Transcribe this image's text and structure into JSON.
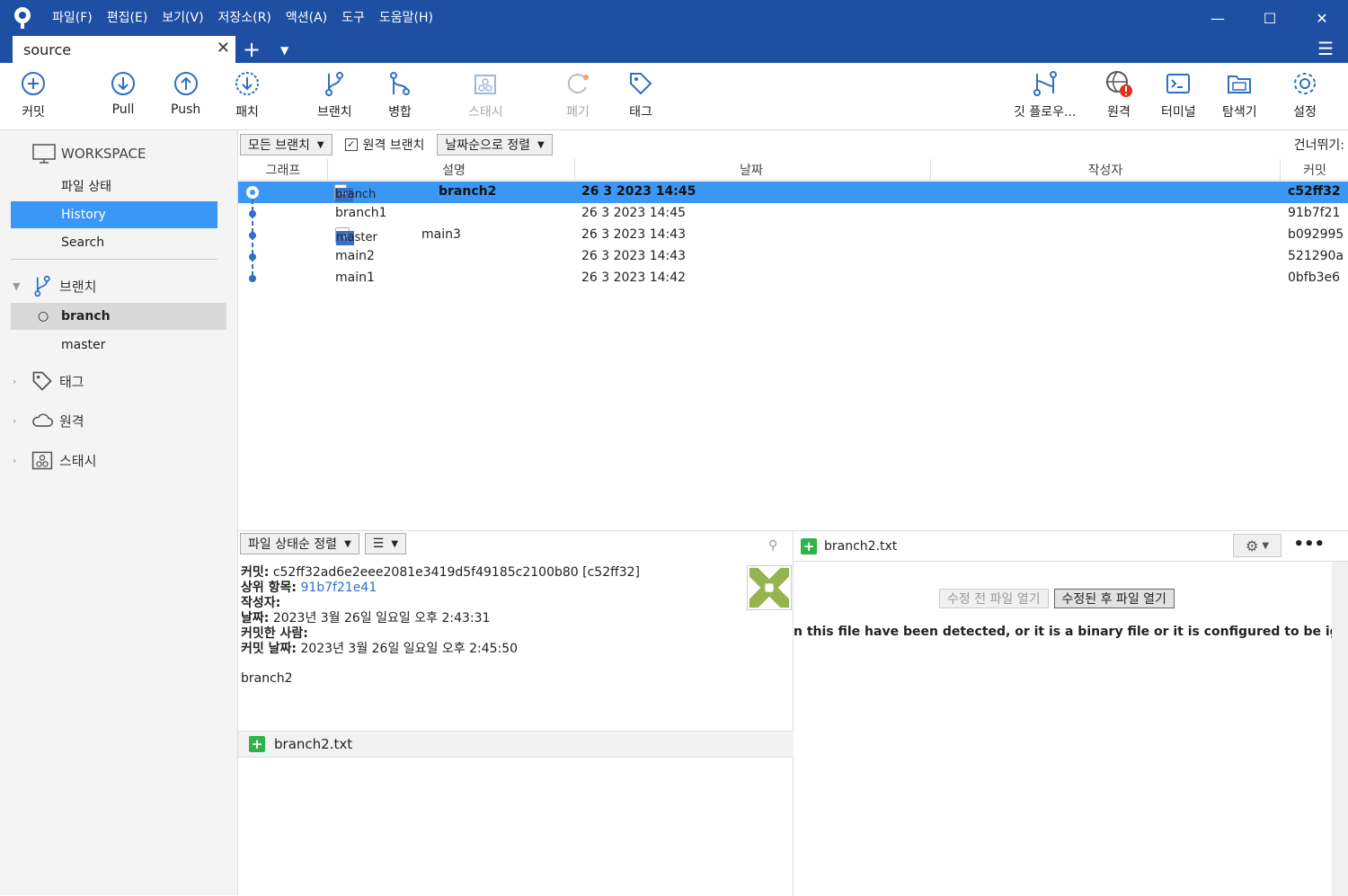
{
  "menu": [
    "파일(F)",
    "편집(E)",
    "보기(V)",
    "저장소(R)",
    "액션(A)",
    "도구",
    "도움말(H)"
  ],
  "tab": {
    "label": "source"
  },
  "toolbar": {
    "commit": "커밋",
    "pull": "Pull",
    "push": "Push",
    "patch": "패치",
    "branch": "브랜치",
    "merge": "병합",
    "stash": "스태시",
    "discard": "폐기",
    "tag": "태그",
    "gitflow": "깃 플로우...",
    "remote": "원격",
    "terminal": "터미널",
    "explorer": "탐색기",
    "settings": "설정"
  },
  "sidebar": {
    "workspace": "WORKSPACE",
    "items": [
      "파일 상태",
      "History",
      "Search"
    ],
    "branches_label": "브랜치",
    "branches": [
      "branch",
      "master"
    ],
    "tags_label": "태그",
    "remotes_label": "원격",
    "stash_label": "스태시"
  },
  "filter": {
    "branches": "모든 브랜치",
    "remote_checkbox": "원격 브랜치",
    "sort": "날짜순으로 정렬",
    "skip": "건너뛰기:"
  },
  "columns": {
    "graph": "그래프",
    "desc": "설명",
    "date": "날짜",
    "author": "작성자",
    "commit": "커밋"
  },
  "commits": [
    {
      "tag": "branch",
      "desc": "branch2",
      "date": "26 3 2023 14:45",
      "hash": "c52ff32"
    },
    {
      "tag": "",
      "desc": "branch1",
      "date": "26 3 2023 14:45",
      "hash": "91b7f21"
    },
    {
      "tag": "master",
      "desc": "main3",
      "date": "26 3 2023 14:43",
      "hash": "b092995"
    },
    {
      "tag": "",
      "desc": "main2",
      "date": "26 3 2023 14:43",
      "hash": "521290a"
    },
    {
      "tag": "",
      "desc": "main1",
      "date": "26 3 2023 14:42",
      "hash": "0bfb3e6"
    }
  ],
  "bottom": {
    "sort": "파일 상태순 정렬",
    "list_icon": "☰",
    "details": {
      "commit_label": "커밋:",
      "commit_value": "c52ff32ad6e2eee2081e3419d5f49185c2100b80 [c52ff32]",
      "parent_label": "상위 항목:",
      "parent_value": "91b7f21e41",
      "author_label": "작성자:",
      "date_label": "날짜:",
      "date_value": "2023년 3월 26일 일요일 오후 2:43:31",
      "committer_label": "커밋한 사람:",
      "commit_date_label": "커밋 날짜:",
      "commit_date_value": "2023년 3월 26일 일요일 오후 2:45:50",
      "message": "branch2"
    },
    "file": "branch2.txt",
    "diff": {
      "file": "branch2.txt",
      "open_before": "수정 전 파일 열기",
      "open_after": "수정된 후 파일 열기",
      "message": "n this file have been detected, or it is a binary file or it is configured to be ignored by the"
    }
  },
  "colors": {
    "accent": "#1e4fa3",
    "selection": "#3b97f5",
    "add": "#2eb34a"
  }
}
